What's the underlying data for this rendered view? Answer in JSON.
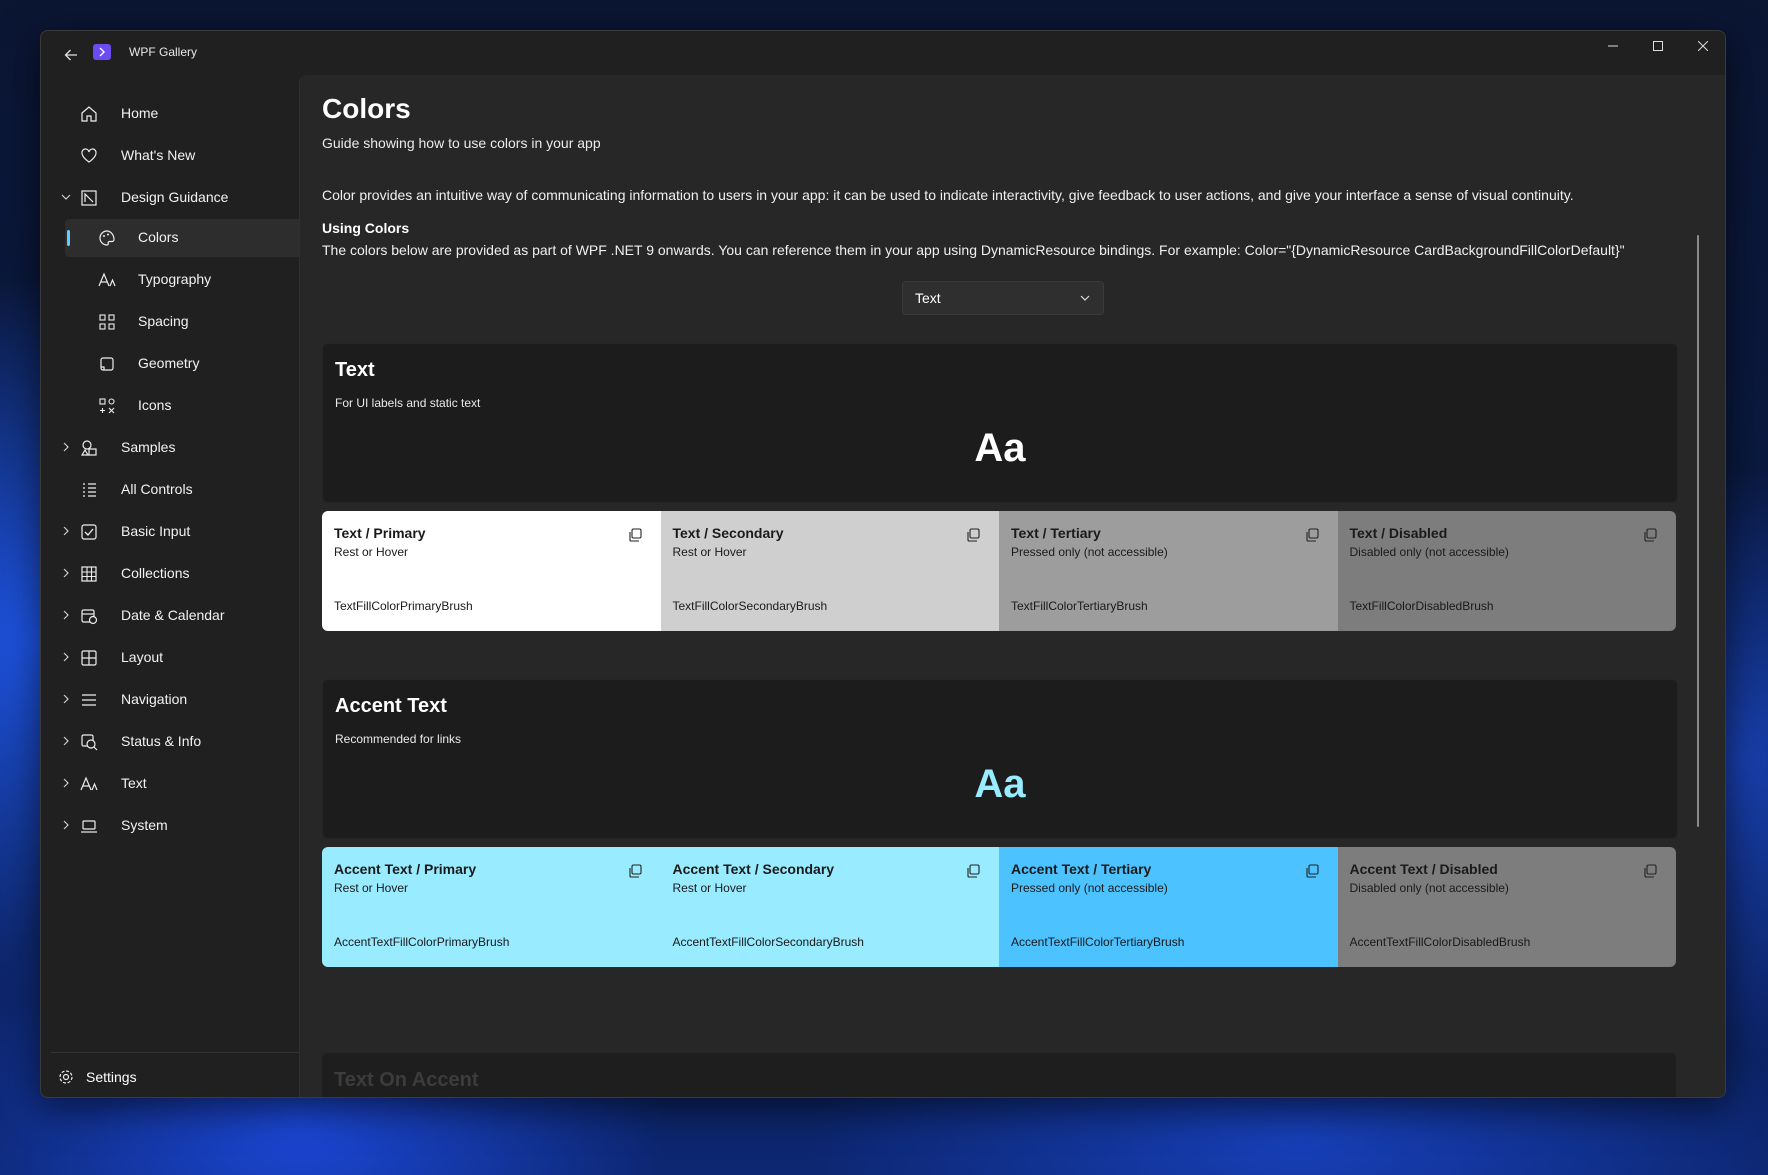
{
  "window": {
    "title": "WPF Gallery"
  },
  "sidebar": {
    "items": [
      {
        "label": "Home",
        "icon": "home-icon"
      },
      {
        "label": "What's New",
        "icon": "heart-icon"
      },
      {
        "label": "Design Guidance",
        "icon": "design-guidance-icon",
        "expanded": true
      },
      {
        "label": "Colors",
        "icon": "palette-icon",
        "selected": true
      },
      {
        "label": "Typography",
        "icon": "typography-icon"
      },
      {
        "label": "Spacing",
        "icon": "spacing-icon"
      },
      {
        "label": "Geometry",
        "icon": "geometry-icon"
      },
      {
        "label": "Icons",
        "icon": "icons-icon"
      },
      {
        "label": "Samples",
        "icon": "samples-icon"
      },
      {
        "label": "All Controls",
        "icon": "list-icon"
      },
      {
        "label": "Basic Input",
        "icon": "checkbox-icon"
      },
      {
        "label": "Collections",
        "icon": "grid-icon"
      },
      {
        "label": "Date & Calendar",
        "icon": "calendar-icon"
      },
      {
        "label": "Layout",
        "icon": "layout-icon"
      },
      {
        "label": "Navigation",
        "icon": "navigation-icon"
      },
      {
        "label": "Status & Info",
        "icon": "status-icon"
      },
      {
        "label": "Text",
        "icon": "text-icon"
      },
      {
        "label": "System",
        "icon": "laptop-icon"
      }
    ],
    "settings_label": "Settings"
  },
  "page": {
    "title": "Colors",
    "subtitle": "Guide showing how to use colors in your app",
    "intro": "Color provides an intuitive way of communicating information to users in your app: it can be used to indicate interactivity, give feedback to user actions, and give your interface a sense of visual continuity.",
    "using_title": "Using Colors",
    "using_text": "The colors below are provided as part of WPF .NET 9 onwards. You can reference them in your app using DynamicResource bindings. For example: Color=\"{DynamicResource CardBackgroundFillColorDefault}\"",
    "combo_value": "Text"
  },
  "sections": [
    {
      "title": "Text",
      "subtitle": "For UI labels and static text",
      "sample": "Aa",
      "sample_color": "#ffffff",
      "swatches": [
        {
          "title": "Text / Primary",
          "sub": "Rest or Hover",
          "brush": "TextFillColorPrimaryBrush",
          "bg": "#ffffff",
          "fg": "#1a1a1a"
        },
        {
          "title": "Text / Secondary",
          "sub": "Rest or Hover",
          "brush": "TextFillColorSecondaryBrush",
          "bg": "#cfcfcf",
          "fg": "#1a1a1a"
        },
        {
          "title": "Text / Tertiary",
          "sub": "Pressed only (not accessible)",
          "brush": "TextFillColorTertiaryBrush",
          "bg": "#9d9d9d",
          "fg": "#1a1a1a"
        },
        {
          "title": "Text / Disabled",
          "sub": "Disabled only (not accessible)",
          "brush": "TextFillColorDisabledBrush",
          "bg": "#7d7d7d",
          "fg": "#1a1a1a"
        }
      ]
    },
    {
      "title": "Accent Text",
      "subtitle": "Recommended for links",
      "sample": "Aa",
      "sample_color": "#99ebff",
      "swatches": [
        {
          "title": "Accent Text / Primary",
          "sub": "Rest or Hover",
          "brush": "AccentTextFillColorPrimaryBrush",
          "bg": "#99ebff",
          "fg": "#1a1a1a"
        },
        {
          "title": "Accent Text / Secondary",
          "sub": "Rest or Hover",
          "brush": "AccentTextFillColorSecondaryBrush",
          "bg": "#99ebff",
          "fg": "#1a1a1a"
        },
        {
          "title": "Accent Text / Tertiary",
          "sub": "Pressed only (not accessible)",
          "brush": "AccentTextFillColorTertiaryBrush",
          "bg": "#4cc2ff",
          "fg": "#1a1a1a"
        },
        {
          "title": "Accent Text / Disabled",
          "sub": "Disabled only (not accessible)",
          "brush": "AccentTextFillColorDisabledBrush",
          "bg": "#7d7d7d",
          "fg": "#1a1a1a"
        }
      ]
    }
  ],
  "peek_section": {
    "title": "Text On Accent"
  },
  "colors": {
    "accent": "#60cdff",
    "window_bg": "#202020",
    "content_bg": "#272727"
  }
}
